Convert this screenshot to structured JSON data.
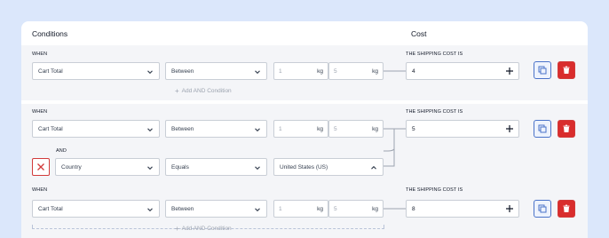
{
  "header": {
    "conditions": "Conditions",
    "cost": "Cost"
  },
  "rules": [
    {
      "when": "WHEN",
      "cost_label": "THE SHIPPING COST IS",
      "condition": {
        "field": "Cart Total",
        "operator": "Between",
        "from": "1",
        "from_unit": "kg",
        "to": "5",
        "to_unit": "kg"
      },
      "cost": "4",
      "add_and": "Add AND Condition"
    },
    {
      "when": "WHEN",
      "cost_label": "THE SHIPPING COST IS",
      "condition": {
        "field": "Cart Total",
        "operator": "Between",
        "from": "1",
        "from_unit": "kg",
        "to": "5",
        "to_unit": "kg"
      },
      "and_label": "AND",
      "and_condition": {
        "field": "Country",
        "operator": "Equals",
        "value": "United States (US)"
      },
      "cost": "5"
    },
    {
      "when": "WHEN",
      "cost_label": "THE SHIPPING COST IS",
      "condition": {
        "field": "Cart Total",
        "operator": "Between",
        "from": "1",
        "from_unit": "kg",
        "to": "5",
        "to_unit": "kg"
      },
      "cost": "8",
      "add_and": "Add AND Condition"
    }
  ],
  "icons": {
    "duplicate": "duplicate-icon",
    "delete": "trash-icon",
    "remove": "close-icon",
    "add": "plus-icon",
    "dropdown": "chevron-down-icon",
    "dropup": "chevron-up-icon"
  },
  "colors": {
    "background": "#dbe7fb",
    "danger": "#d92d2d",
    "accent": "#4b73c9"
  }
}
